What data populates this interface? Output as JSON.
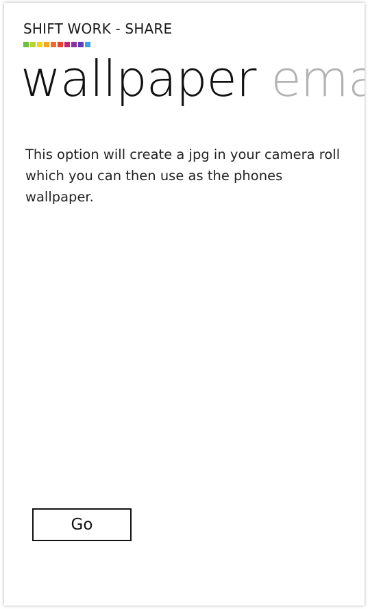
{
  "app": {
    "title": "SHIFT WORK - SHARE",
    "strip_colors": [
      "#6cbf3c",
      "#b8d432",
      "#f5d31c",
      "#f5a623",
      "#f06a2a",
      "#e8412c",
      "#c4237a",
      "#8e2ea0",
      "#5a3fb5",
      "#3aa3e3"
    ]
  },
  "pivot": {
    "items": [
      {
        "label": "wallpaper",
        "active": true
      },
      {
        "label": "ema",
        "active": false
      }
    ]
  },
  "content": {
    "description": "This option will create a jpg in your camera roll which you can then use as the phones wallpaper.",
    "go_label": "Go"
  }
}
